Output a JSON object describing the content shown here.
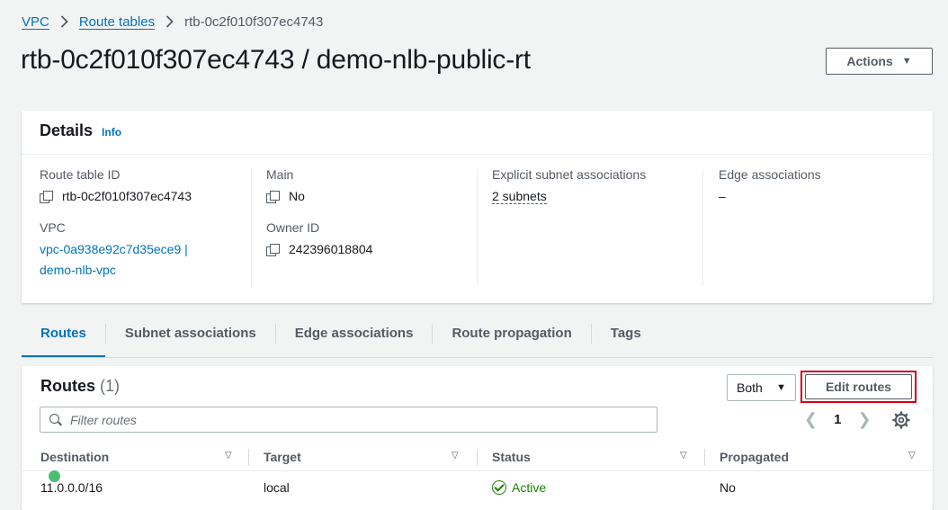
{
  "breadcrumb": {
    "vpc": "VPC",
    "route_tables": "Route tables",
    "current": "rtb-0c2f010f307ec4743"
  },
  "page": {
    "title": "rtb-0c2f010f307ec4743 / demo-nlb-public-rt",
    "actions_label": "Actions"
  },
  "details": {
    "title": "Details",
    "info_label": "Info",
    "route_table_id": {
      "label": "Route table ID",
      "value": "rtb-0c2f010f307ec4743"
    },
    "main": {
      "label": "Main",
      "value": "No"
    },
    "explicit_subnet": {
      "label": "Explicit subnet associations",
      "value": "2 subnets"
    },
    "edge": {
      "label": "Edge associations",
      "value": "–"
    },
    "vpc": {
      "label": "VPC",
      "line1": "vpc-0a938e92c7d35ece9 |",
      "line2": "demo-nlb-vpc"
    },
    "owner": {
      "label": "Owner ID",
      "value": "242396018804"
    }
  },
  "tabs": [
    {
      "label": "Routes",
      "active": true
    },
    {
      "label": "Subnet associations"
    },
    {
      "label": "Edge associations"
    },
    {
      "label": "Route propagation"
    },
    {
      "label": "Tags"
    }
  ],
  "routes": {
    "title": "Routes",
    "count": "(1)",
    "filter_selected": "Both",
    "edit_label": "Edit routes",
    "search_placeholder": "Filter routes",
    "page": "1",
    "columns": [
      "Destination",
      "Target",
      "Status",
      "Propagated"
    ],
    "rows": [
      {
        "destination": "11.0.0.0/16",
        "target": "local",
        "status": "Active",
        "propagated": "No"
      }
    ]
  },
  "colors": {
    "link": "#0073bb",
    "status_active": "#1d8102",
    "highlight_border": "#d0021b"
  }
}
